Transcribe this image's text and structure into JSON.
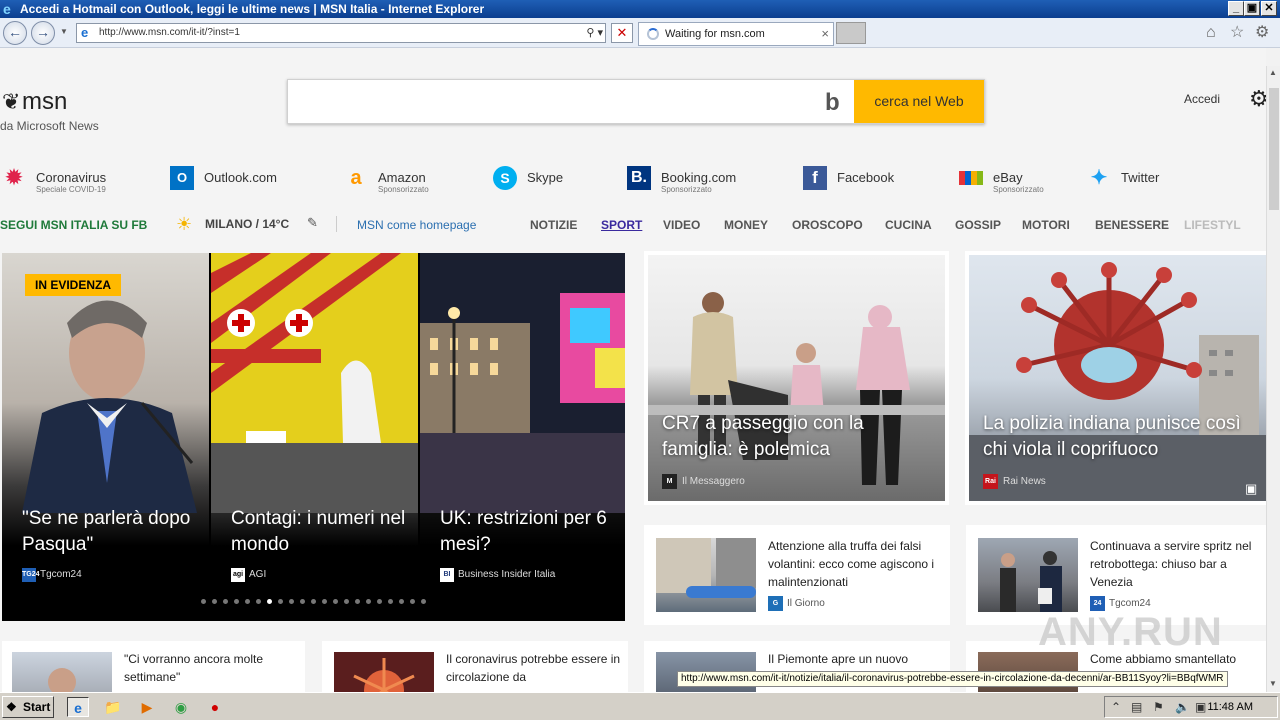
{
  "window": {
    "title": "Accedi a Hotmail con Outlook, leggi le ultime news | MSN Italia - Internet Explorer",
    "controls": [
      "_",
      "▣",
      "✕"
    ]
  },
  "browser": {
    "address": "http://www.msn.com/it-it/?inst=1",
    "tab_label": "Waiting for msn.com",
    "icons": [
      "back-icon",
      "forward-icon",
      "search-icon",
      "stop-icon",
      "home-icon",
      "favorites-star-icon",
      "gear-icon"
    ]
  },
  "header": {
    "logo": "msn",
    "logo_sub": "da Microsoft News",
    "search_button": "cerca nel Web",
    "signin": "Accedi"
  },
  "quick_links": [
    {
      "name": "Coronavirus",
      "sub": "Speciale COVID-19",
      "icon": "coronavirus-icon",
      "color": "#e0244c"
    },
    {
      "name": "Outlook.com",
      "sub": "",
      "icon": "outlook-icon",
      "color": "#0072c6"
    },
    {
      "name": "Amazon",
      "sub": "Sponsorizzato",
      "icon": "amazon-icon",
      "color": "#ff9900"
    },
    {
      "name": "Skype",
      "sub": "",
      "icon": "skype-icon",
      "color": "#00aff0"
    },
    {
      "name": "Booking.com",
      "sub": "Sponsorizzato",
      "icon": "booking-icon",
      "color": "#003580"
    },
    {
      "name": "Facebook",
      "sub": "",
      "icon": "facebook-icon",
      "color": "#3b5998"
    },
    {
      "name": "eBay",
      "sub": "Sponsorizzato",
      "icon": "ebay-icon",
      "color": "#e53238"
    },
    {
      "name": "Twitter",
      "sub": "",
      "icon": "twitter-icon",
      "color": "#1da1f2"
    }
  ],
  "nav": {
    "fb_follow": "SEGUI MSN ITALIA SU FB",
    "weather": "MILANO / 14°C",
    "homepage_link": "MSN come homepage",
    "items": [
      "NOTIZIE",
      "SPORT",
      "VIDEO",
      "MONEY",
      "OROSCOPO",
      "CUCINA",
      "GOSSIP",
      "MOTORI",
      "BENESSERE",
      "LIFESTYL"
    ]
  },
  "carousel": {
    "badge": "IN EVIDENZA",
    "slides": [
      {
        "title": "\"Se ne parlerà dopo Pasqua\"",
        "source": "Tgcom24",
        "source_icon": "TG24"
      },
      {
        "title": "Contagi: i numeri nel mondo",
        "source": "AGI",
        "source_icon": "agi"
      },
      {
        "title": "UK: restrizioni per 6 mesi?",
        "source": "Business Insider Italia",
        "source_icon": "BI"
      }
    ],
    "dot_count": 21,
    "active_dot": 6
  },
  "big_cards": [
    {
      "title": "CR7 a passeggio con la famiglia: è polemica",
      "source": "Il Messaggero",
      "source_icon": "M"
    },
    {
      "title": "La polizia indiana punisce così chi viola il coprifuoco",
      "source": "Rai News",
      "source_icon": "Rai"
    }
  ],
  "small_cards": [
    {
      "title": "Attenzione alla truffa dei falsi volantini: ecco come agiscono i malintenzionati",
      "source": "Il Giorno",
      "source_icon": "G"
    },
    {
      "title": "Continuava a servire spritz nel retrobottega: chiuso bar a Venezia",
      "source": "Tgcom24",
      "source_icon": "24"
    },
    {
      "title": "\"Ci vorranno ancora molte settimane\"",
      "source": "",
      "source_icon": ""
    },
    {
      "title": "Il coronavirus potrebbe essere in circolazione da",
      "source": "",
      "source_icon": ""
    },
    {
      "title": "Il Piemonte apre un nuovo",
      "source": "",
      "source_icon": ""
    },
    {
      "title": "Come abbiamo smantellato",
      "source": "",
      "source_icon": ""
    }
  ],
  "status_url": "http://www.msn.com/it-it/notizie/italia/il-coronavirus-potrebbe-essere-in-circolazione-da-decenni/ar-BB11Syoy?li=BBqfWMR",
  "watermark": "ANY.RUN",
  "taskbar": {
    "start": "Start",
    "clock": "11:48 AM"
  }
}
